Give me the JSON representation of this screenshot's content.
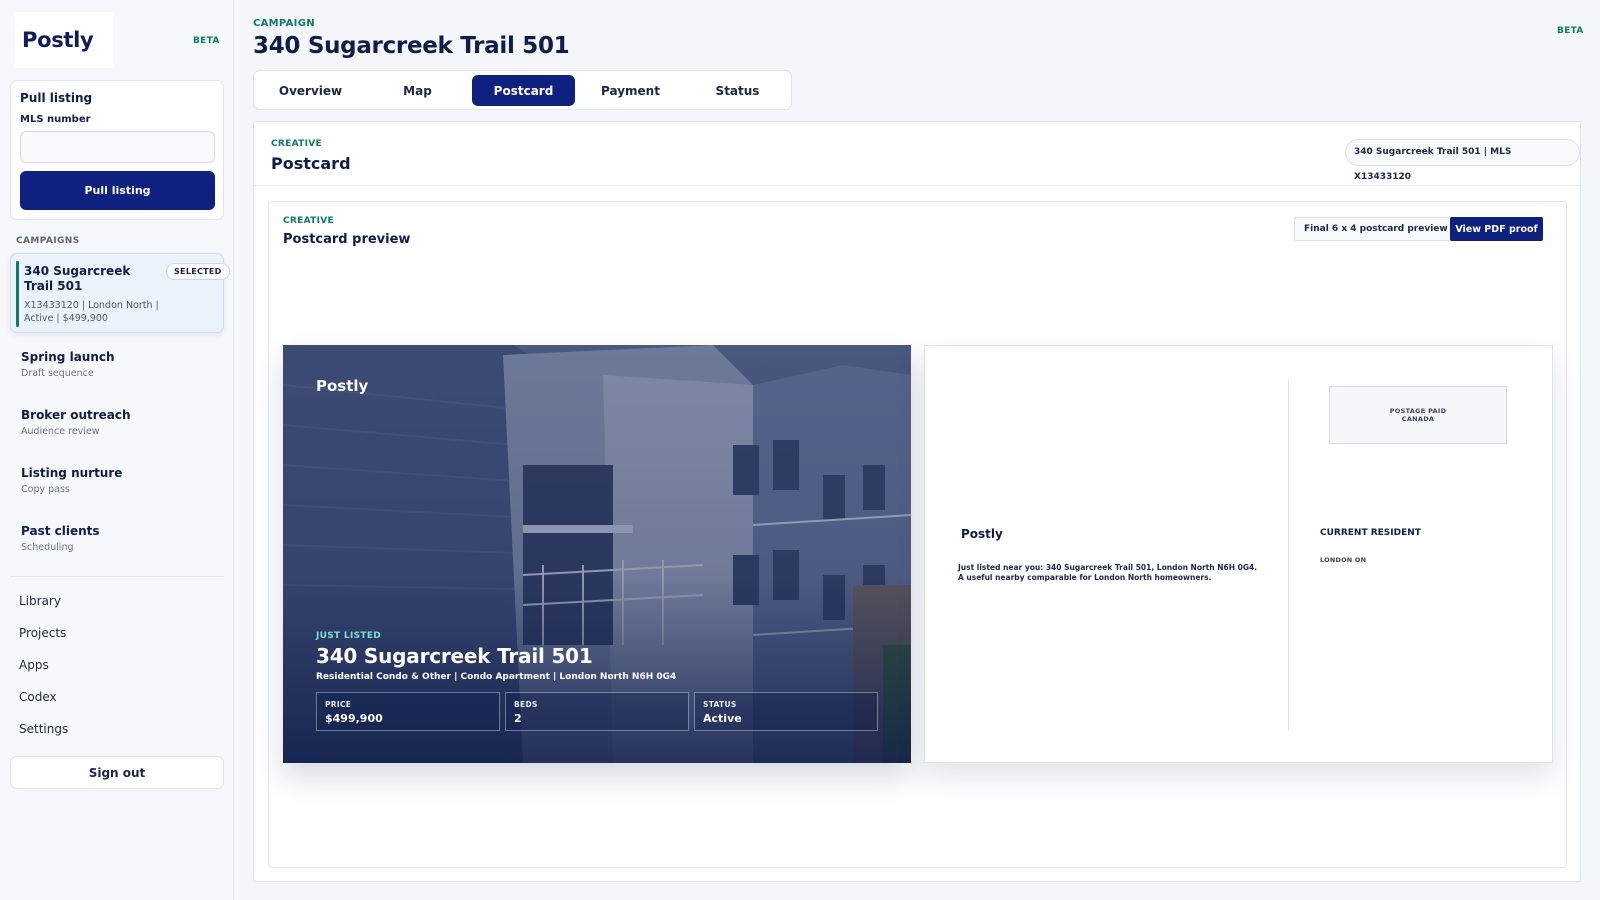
{
  "brand": {
    "name": "Postly",
    "beta": "BETA"
  },
  "sidebar": {
    "pull_listing": {
      "title": "Pull listing",
      "mls_label": "MLS number",
      "mls_value": "",
      "button_label": "Pull listing"
    },
    "campaigns_heading": "CAMPAIGNS",
    "selected_campaign": {
      "title": "340 Sugarcreek Trail 501",
      "badge": "SELECTED",
      "meta": "X13433120 | London North | Active | $499,900"
    },
    "campaigns": [
      {
        "title": "Spring launch",
        "subtitle": "Draft sequence"
      },
      {
        "title": "Broker outreach",
        "subtitle": "Audience review"
      },
      {
        "title": "Listing nurture",
        "subtitle": "Copy pass"
      },
      {
        "title": "Past clients",
        "subtitle": "Scheduling"
      }
    ],
    "nav": [
      "Library",
      "Projects",
      "Apps",
      "Codex",
      "Settings"
    ],
    "sign_out": "Sign out"
  },
  "header": {
    "eyebrow": "CAMPAIGN",
    "title": "340 Sugarcreek Trail 501",
    "beta": "BETA"
  },
  "tabs": [
    {
      "label": "Overview",
      "active": false
    },
    {
      "label": "Map",
      "active": false
    },
    {
      "label": "Postcard",
      "active": true
    },
    {
      "label": "Payment",
      "active": false
    },
    {
      "label": "Status",
      "active": false
    }
  ],
  "panel": {
    "eyebrow": "CREATIVE",
    "title": "Postcard",
    "listing_pill": "340 Sugarcreek Trail 501 | MLS X13433120"
  },
  "preview": {
    "eyebrow": "CREATIVE",
    "title": "Postcard preview",
    "final_label": "Final 6 x 4 postcard preview",
    "pdf_label": "View PDF proof"
  },
  "postcard_front": {
    "logo": "Postly",
    "eyebrow": "JUST LISTED",
    "title": "340 Sugarcreek Trail 501",
    "subtitle": "Residential Condo & Other | Condo Apartment | London North N6H 0G4",
    "stats": [
      {
        "label": "PRICE",
        "value": "$499,900"
      },
      {
        "label": "BEDS",
        "value": "2"
      },
      {
        "label": "STATUS",
        "value": "Active"
      }
    ]
  },
  "postcard_back": {
    "postage": "POSTAGE PAID CANADA",
    "logo": "Postly",
    "blurb": "Just listed near you: 340 Sugarcreek Trail 501, London North N6H 0G4. A useful nearby comparable for London North homeowners.",
    "recipient": "CURRENT RESIDENT",
    "city": "LONDON ON"
  },
  "colors": {
    "primary": "#0f2180",
    "accent": "#0f7a64",
    "ink": "#0f1d4a"
  }
}
